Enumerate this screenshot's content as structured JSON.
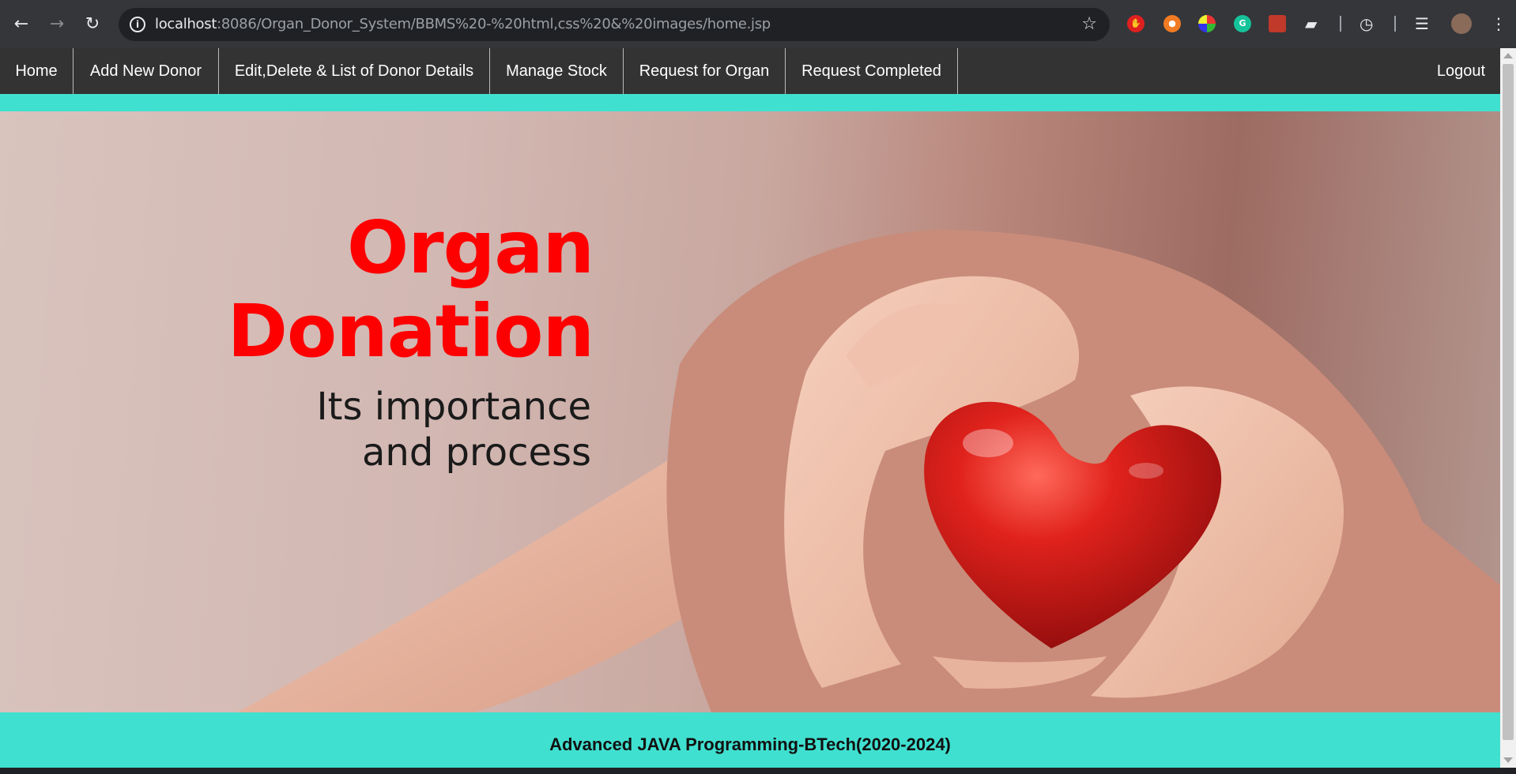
{
  "browser": {
    "url_host": "localhost",
    "url_path": ":8086/Organ_Donor_System/BBMS%20-%20html,css%20&%20images/home.jsp",
    "icons": {
      "back": "arrow-left-icon",
      "forward": "arrow-right-icon",
      "reload": "reload-icon",
      "info": "info-icon",
      "bookmark": "star-icon",
      "extensions": "puzzle-icon",
      "history": "history-icon",
      "reading_list": "reading-list-icon",
      "menu": "kebab-menu-icon"
    }
  },
  "nav": {
    "items": [
      "Home",
      "Add New Donor",
      "Edit,Delete & List of Donor Details",
      "Manage Stock",
      "Request for Organ",
      "Request Completed"
    ],
    "logout": "Logout"
  },
  "banner": {
    "headline_line1": "Organ",
    "headline_line2": "Donation",
    "subline_line1": "Its importance",
    "subline_line2": "and process"
  },
  "footer": {
    "text": "Advanced JAVA Programming-BTech(2020-2024)"
  },
  "colors": {
    "nav_bg": "#333333",
    "accent_teal": "#40e0d0",
    "headline_red": "#ff0000"
  }
}
